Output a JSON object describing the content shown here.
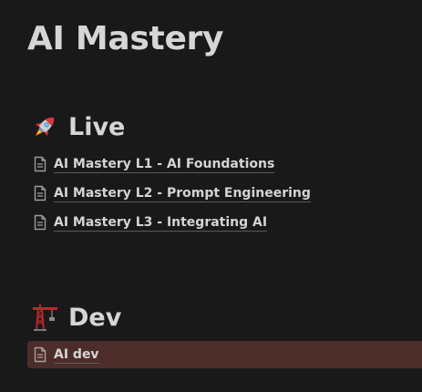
{
  "page": {
    "title": "AI Mastery"
  },
  "sections": [
    {
      "heading": "Live",
      "icon": "rocket-icon",
      "items": [
        {
          "label": "AI Mastery L1 - AI Foundations",
          "icon": "page-icon"
        },
        {
          "label": "AI Mastery L2 - Prompt Engineering",
          "icon": "page-icon"
        },
        {
          "label": "AI Mastery L3 - Integrating AI",
          "icon": "page-icon"
        }
      ]
    },
    {
      "heading": "Dev",
      "icon": "construction-crane-icon",
      "items": [
        {
          "label": "AI dev",
          "icon": "page-icon",
          "selected": true
        }
      ]
    }
  ],
  "colors": {
    "background": "#1a1919",
    "text": "#d4d4d4",
    "selected_row": "#4d2d2a"
  }
}
